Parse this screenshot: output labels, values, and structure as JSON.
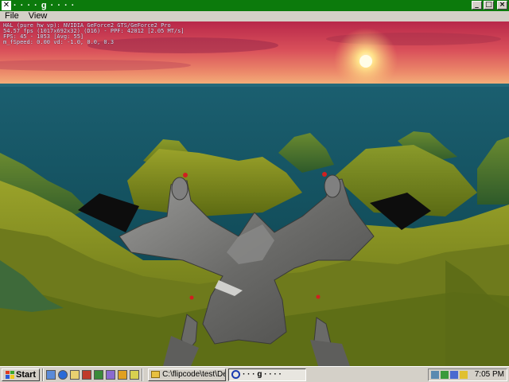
{
  "window": {
    "title": "· · · · g · · · ·",
    "app_icon": "x-icon",
    "controls": [
      {
        "name": "minimize-button",
        "glyph": "_"
      },
      {
        "name": "maximize-button",
        "glyph": "□"
      },
      {
        "name": "close-button",
        "glyph": "×"
      }
    ]
  },
  "menu": {
    "items": [
      "File",
      "View"
    ]
  },
  "hud": {
    "lines": [
      "HAL (pure hw vp): NVIDIA GeForce2 GTS/GeForce2 Pro",
      "54.57 fps (1017x692x32) (D16) - PPF: 42012 [2.05 MT/s]",
      "FPS: 45 - 1053 [Avg: 55]",
      "m_fSpeed: 0.00 vd: -1.0, 0.0, 0.3"
    ]
  },
  "scene": {
    "colors": {
      "sky_top": "#c0304a",
      "sky_mid": "#d95a5a",
      "sky_horizon": "#f0a070",
      "sun": "#fff7c0",
      "sea": "#0f5a66",
      "grass": "#7a8a22",
      "craft": "#7a7a78"
    }
  },
  "taskbar": {
    "start_label": "Start",
    "quick_launch": [
      "desktop-icon",
      "ie-icon",
      "outlook-icon",
      "app-icon",
      "media-icon",
      "app2-icon",
      "app3-icon",
      "app4-icon"
    ],
    "tasks": [
      {
        "label": "C:\\flipcode\\test\\DevVis...",
        "icon": "folder-icon",
        "active": false
      },
      {
        "label": "· · · g · · · ·",
        "icon": "directx-icon",
        "active": true
      }
    ],
    "tray_icons": [
      "volume-icon",
      "network-icon",
      "monitor-icon",
      "speaker-icon"
    ],
    "clock": "7:05 PM"
  }
}
